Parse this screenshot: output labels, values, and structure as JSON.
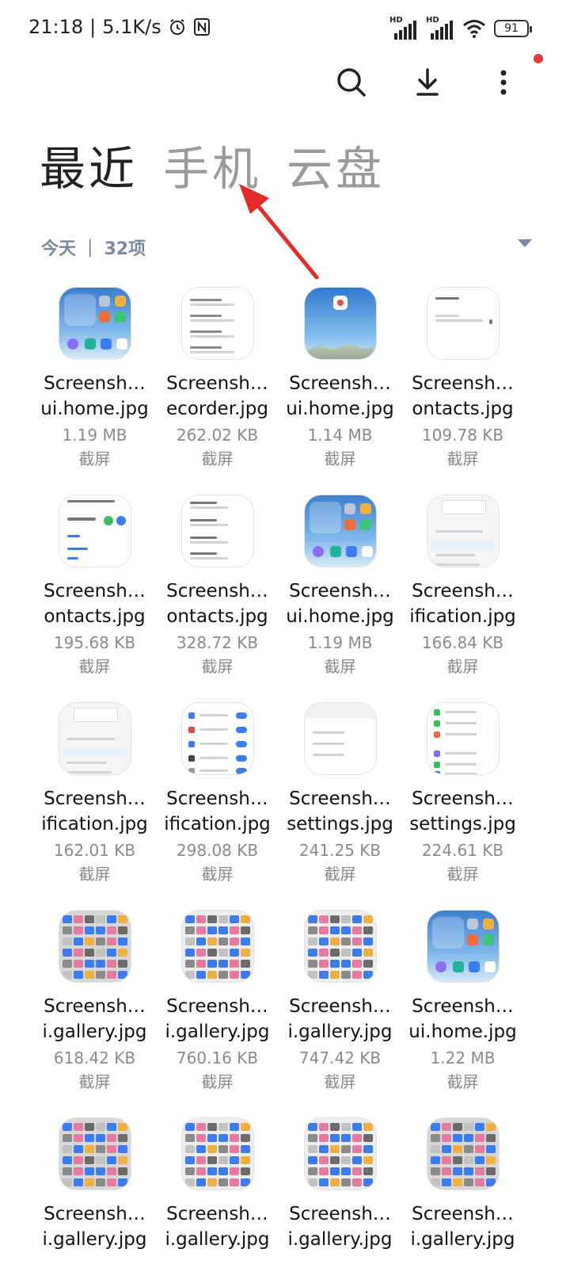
{
  "status_bar": {
    "time": "21:18",
    "network_speed": "5.1K/s",
    "battery": "91",
    "signal_label_1": "HD",
    "signal_label_2": "HD"
  },
  "toolbar": {
    "search_icon": "search-icon",
    "download_icon": "download-icon",
    "more_icon": "more-vertical-icon"
  },
  "tabs": [
    {
      "label": "最近",
      "active": true
    },
    {
      "label": "手机",
      "active": false
    },
    {
      "label": "云盘",
      "active": false
    }
  ],
  "section": {
    "date": "今天",
    "separator": "|",
    "count": "32项"
  },
  "files": [
    {
      "name1": "Screensh…",
      "name2": "ui.home.jpg",
      "size": "1.19 MB",
      "kind": "截屏",
      "thumb": "home"
    },
    {
      "name1": "Screensh…",
      "name2": "ecorder.jpg",
      "size": "262.02 KB",
      "kind": "截屏",
      "thumb": "recorder"
    },
    {
      "name1": "Screensh…",
      "name2": "ui.home.jpg",
      "size": "1.14 MB",
      "kind": "截屏",
      "thumb": "sky"
    },
    {
      "name1": "Screensh…",
      "name2": "ontacts.jpg",
      "size": "109.78 KB",
      "kind": "截屏",
      "thumb": "contacts-a"
    },
    {
      "name1": "Screensh…",
      "name2": "ontacts.jpg",
      "size": "195.68 KB",
      "kind": "截屏",
      "thumb": "contacts-b"
    },
    {
      "name1": "Screensh…",
      "name2": "ontacts.jpg",
      "size": "328.72 KB",
      "kind": "截屏",
      "thumb": "contacts-c"
    },
    {
      "name1": "Screensh…",
      "name2": "ui.home.jpg",
      "size": "1.19 MB",
      "kind": "截屏",
      "thumb": "home"
    },
    {
      "name1": "Screensh…",
      "name2": "ification.jpg",
      "size": "166.84 KB",
      "kind": "截屏",
      "thumb": "notif-a"
    },
    {
      "name1": "Screensh…",
      "name2": "ification.jpg",
      "size": "162.01 KB",
      "kind": "截屏",
      "thumb": "notif-a"
    },
    {
      "name1": "Screensh…",
      "name2": "ification.jpg",
      "size": "298.08 KB",
      "kind": "截屏",
      "thumb": "notif-b"
    },
    {
      "name1": "Screensh…",
      "name2": "settings.jpg",
      "size": "241.25 KB",
      "kind": "截屏",
      "thumb": "settings-a"
    },
    {
      "name1": "Screensh…",
      "name2": "settings.jpg",
      "size": "224.61 KB",
      "kind": "截屏",
      "thumb": "settings-b"
    },
    {
      "name1": "Screensh…",
      "name2": "i.gallery.jpg",
      "size": "618.42 KB",
      "kind": "截屏",
      "thumb": "gallery-dark"
    },
    {
      "name1": "Screensh…",
      "name2": "i.gallery.jpg",
      "size": "760.16 KB",
      "kind": "截屏",
      "thumb": "gallery-light"
    },
    {
      "name1": "Screensh…",
      "name2": "i.gallery.jpg",
      "size": "747.42 KB",
      "kind": "截屏",
      "thumb": "gallery-light"
    },
    {
      "name1": "Screensh…",
      "name2": "ui.home.jpg",
      "size": "1.22 MB",
      "kind": "截屏",
      "thumb": "home"
    },
    {
      "name1": "Screensh…",
      "name2": "i.gallery.jpg",
      "size": "",
      "kind": "",
      "thumb": "gallery-dark"
    },
    {
      "name1": "Screensh…",
      "name2": "i.gallery.jpg",
      "size": "",
      "kind": "",
      "thumb": "gallery-light"
    },
    {
      "name1": "Screensh…",
      "name2": "i.gallery.jpg",
      "size": "",
      "kind": "",
      "thumb": "gallery-light"
    },
    {
      "name1": "Screensh…",
      "name2": "i.gallery.jpg",
      "size": "",
      "kind": "",
      "thumb": "gallery-dark"
    }
  ],
  "colors": {
    "active_tab": "#222222",
    "inactive_tab": "#9b9b9b",
    "section_text": "#7a8aa3",
    "notification_dot": "#e93b3b"
  }
}
